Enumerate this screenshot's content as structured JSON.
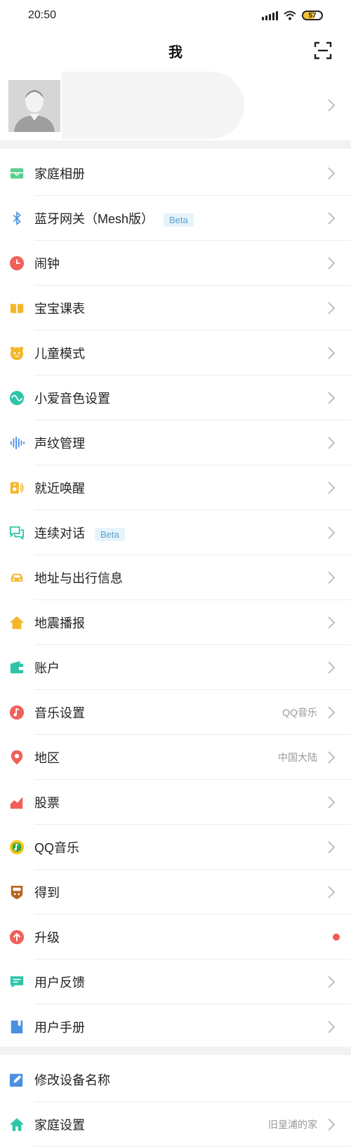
{
  "status_bar": {
    "time": "20:50",
    "battery": "57"
  },
  "nav": {
    "title": "我"
  },
  "menu_items": [
    {
      "label": "家庭相册",
      "icon": "photo-album-icon",
      "color": "#5ccf8f"
    },
    {
      "label": "蓝牙网关（Mesh版）",
      "icon": "bluetooth-icon",
      "color": "#4a90e2",
      "badge": "Beta"
    },
    {
      "label": "闹钟",
      "icon": "clock-icon",
      "color": "#f1605a"
    },
    {
      "label": "宝宝课表",
      "icon": "book-icon",
      "color": "#f5b72a"
    },
    {
      "label": "儿童模式",
      "icon": "child-face-icon",
      "color": "#f5b72a"
    },
    {
      "label": "小爱音色设置",
      "icon": "wave-icon",
      "color": "#2ec4a8"
    },
    {
      "label": "声纹管理",
      "icon": "voiceprint-icon",
      "color": "#4a90e2"
    },
    {
      "label": "就近唤醒",
      "icon": "speaker-icon",
      "color": "#f5b72a"
    },
    {
      "label": "连续对话",
      "icon": "chat-icon",
      "color": "#2ec4a8",
      "badge": "Beta"
    },
    {
      "label": "地址与出行信息",
      "icon": "car-icon",
      "color": "#f5b72a"
    },
    {
      "label": "地震播报",
      "icon": "house-icon",
      "color": "#f5b72a"
    },
    {
      "label": "账户",
      "icon": "wallet-icon",
      "color": "#2ec4a8"
    },
    {
      "label": "音乐设置",
      "icon": "music-note-icon",
      "color": "#f1605a",
      "value": "QQ音乐"
    },
    {
      "label": "地区",
      "icon": "location-pin-icon",
      "color": "#f1605a",
      "value": "中国大陆"
    },
    {
      "label": "股票",
      "icon": "stock-chart-icon",
      "color": "#f1605a"
    },
    {
      "label": "QQ音乐",
      "icon": "qq-music-icon",
      "color": "#f5c518"
    },
    {
      "label": "得到",
      "icon": "dedao-icon",
      "color": "#b5651d"
    },
    {
      "label": "升级",
      "icon": "upgrade-icon",
      "color": "#f1605a",
      "dot": true
    },
    {
      "label": "用户反馈",
      "icon": "feedback-icon",
      "color": "#2ec4a8"
    },
    {
      "label": "用户手册",
      "icon": "manual-icon",
      "color": "#4a90e2"
    }
  ],
  "device_items": [
    {
      "label": "修改设备名称",
      "icon": "edit-icon",
      "color": "#4a90e2"
    },
    {
      "label": "家庭设置",
      "icon": "home-icon",
      "color": "#2ec4a8",
      "value": "旧皇浦的家"
    }
  ]
}
